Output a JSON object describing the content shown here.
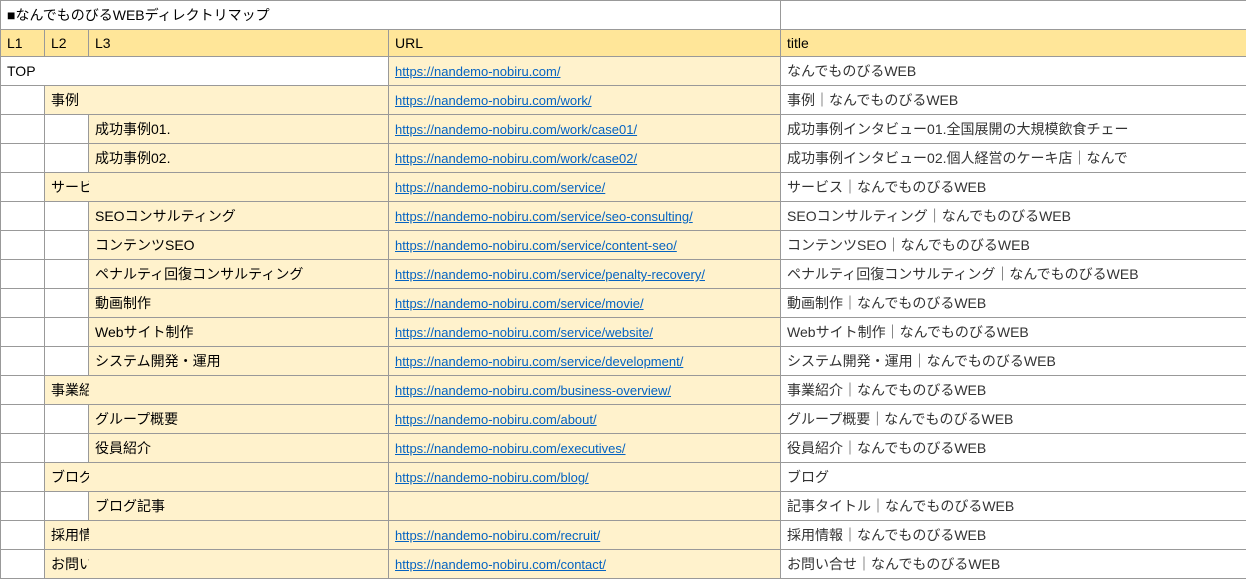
{
  "title": "■なんでものびるWEBディレクトリマップ",
  "headers": {
    "l1": "L1",
    "l2": "L2",
    "l3": "L3",
    "url": "URL",
    "title": "title"
  },
  "rows": [
    {
      "level": 1,
      "label": "TOP",
      "url": "https://nandemo-nobiru.com/",
      "title": "なんでものびるWEB"
    },
    {
      "level": 2,
      "label": "事例",
      "url": "https://nandemo-nobiru.com/work/",
      "title": "事例｜なんでものびるWEB"
    },
    {
      "level": 3,
      "label": "成功事例01.",
      "url": "https://nandemo-nobiru.com/work/case01/",
      "title": "成功事例インタビュー01.全国展開の大規模飲食チェー"
    },
    {
      "level": 3,
      "label": "成功事例02.",
      "url": "https://nandemo-nobiru.com/work/case02/",
      "title": "成功事例インタビュー02.個人経営のケーキ店｜なんで"
    },
    {
      "level": 2,
      "label": "サービス",
      "url": "https://nandemo-nobiru.com/service/",
      "title": "サービス｜なんでものびるWEB"
    },
    {
      "level": 3,
      "label": "SEOコンサルティング",
      "url": "https://nandemo-nobiru.com/service/seo-consulting/",
      "title": "SEOコンサルティング｜なんでものびるWEB"
    },
    {
      "level": 3,
      "label": "コンテンツSEO",
      "url": "https://nandemo-nobiru.com/service/content-seo/",
      "title": "コンテンツSEO｜なんでものびるWEB"
    },
    {
      "level": 3,
      "label": "ペナルティ回復コンサルティング",
      "url": "https://nandemo-nobiru.com/service/penalty-recovery/",
      "title": "ペナルティ回復コンサルティング｜なんでものびるWEB"
    },
    {
      "level": 3,
      "label": "動画制作",
      "url": "https://nandemo-nobiru.com/service/movie/",
      "title": "動画制作｜なんでものびるWEB"
    },
    {
      "level": 3,
      "label": "Webサイト制作",
      "url": "https://nandemo-nobiru.com/service/website/",
      "title": "Webサイト制作｜なんでものびるWEB"
    },
    {
      "level": 3,
      "label": "システム開発・運用",
      "url": "https://nandemo-nobiru.com/service/development/",
      "title": "システム開発・運用｜なんでものびるWEB"
    },
    {
      "level": 2,
      "label": "事業紹介",
      "url": "https://nandemo-nobiru.com/business-overview/",
      "title": "事業紹介｜なんでものびるWEB"
    },
    {
      "level": 3,
      "label": "グループ概要",
      "url": "https://nandemo-nobiru.com/about/",
      "title": "グループ概要｜なんでものびるWEB"
    },
    {
      "level": 3,
      "label": "役員紹介",
      "url": "https://nandemo-nobiru.com/executives/",
      "title": "役員紹介｜なんでものびるWEB"
    },
    {
      "level": 2,
      "label": "ブログ",
      "url": "https://nandemo-nobiru.com/blog/",
      "title": "ブログ"
    },
    {
      "level": 3,
      "label": "ブログ記事",
      "url": "",
      "title": "記事タイトル｜なんでものびるWEB"
    },
    {
      "level": 2,
      "label": "採用情報",
      "url": "https://nandemo-nobiru.com/recruit/",
      "title": "採用情報｜なんでものびるWEB"
    },
    {
      "level": 2,
      "label": "お問い合わせ",
      "url": "https://nandemo-nobiru.com/contact/",
      "title": "お問い合せ｜なんでものびるWEB"
    }
  ]
}
